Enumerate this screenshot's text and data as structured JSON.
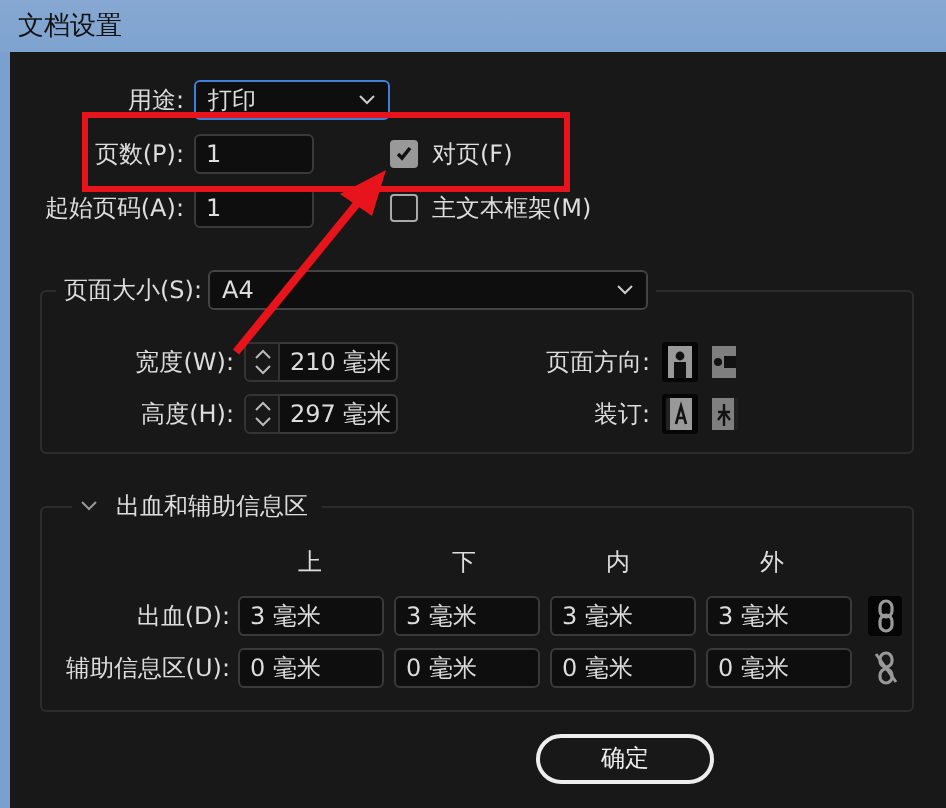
{
  "window": {
    "title": "文档设置"
  },
  "intent": {
    "label": "用途:",
    "value": "打印"
  },
  "pages": {
    "label": "页数(P):",
    "value": "1"
  },
  "facing_pages": {
    "label": "对页(F)",
    "checked": true
  },
  "start_page": {
    "label": "起始页码(A):",
    "value": "1"
  },
  "primary_text_frame": {
    "label": "主文本框架(M)",
    "checked": false
  },
  "page_size": {
    "label": "页面大小(S):",
    "value": "A4"
  },
  "width": {
    "label": "宽度(W):",
    "value": "210 毫米"
  },
  "height": {
    "label": "高度(H):",
    "value": "297 毫米"
  },
  "orientation": {
    "label": "页面方向:",
    "options": [
      {
        "kind": "portrait",
        "selected": true
      },
      {
        "kind": "landscape",
        "selected": false
      }
    ]
  },
  "binding": {
    "label": "装订:",
    "options": [
      {
        "kind": "left",
        "selected": true
      },
      {
        "kind": "right",
        "selected": false
      }
    ]
  },
  "bleed_section": {
    "title": "出血和辅助信息区",
    "expanded": true,
    "columns": [
      "上",
      "下",
      "内",
      "外"
    ],
    "rows": [
      {
        "label": "出血(D):",
        "values": [
          "3 毫米",
          "3 毫米",
          "3 毫米",
          "3 毫米"
        ],
        "linked": true
      },
      {
        "label": "辅助信息区(U):",
        "values": [
          "0 毫米",
          "0 毫米",
          "0 毫米",
          "0 毫米"
        ],
        "linked": false
      }
    ]
  },
  "buttons": [
    {
      "label": "确定"
    }
  ]
}
